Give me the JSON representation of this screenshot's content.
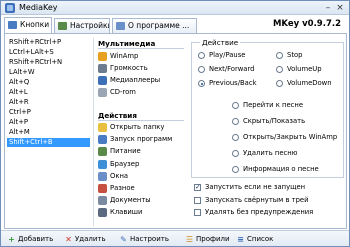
{
  "window": {
    "title": "MediaKey",
    "minimize_glyph": "–",
    "close_glyph": "×"
  },
  "tabs": [
    {
      "label": "Кнопки",
      "icon": "keys-icon",
      "active": true,
      "color": "#4a7cc4"
    },
    {
      "label": "Настройки",
      "icon": "settings-icon",
      "active": false,
      "color": "#5a8a4a"
    },
    {
      "label": "О программе ...",
      "icon": "info-icon",
      "active": false,
      "color": "#6b8fc8"
    }
  ],
  "version": "MKey v0.9.7.2",
  "hotkeys": [
    "RShift+RCtrl+P",
    "LCtrl+LAlt+S",
    "RShift+RCtrl+N",
    "LAlt+W",
    "Alt+Q",
    "Alt+L",
    "Alt+R",
    "Ctrl+P",
    "Alt+P",
    "Alt+M",
    "Shift+Ctrl+B"
  ],
  "selected_hotkey_index": 10,
  "commands": {
    "multimedia_header": "Мультимедиа",
    "multimedia": [
      {
        "label": "WinAmp",
        "icon": "winamp-icon",
        "color": "#e8a020"
      },
      {
        "label": "Громкость",
        "icon": "volume-icon",
        "color": "#6b7c90"
      },
      {
        "label": "Медиаплееры",
        "icon": "media-players-icon",
        "color": "#3d6fb8"
      },
      {
        "label": "CD-rom",
        "icon": "cdrom-icon",
        "color": "#9aa6b4"
      }
    ],
    "actions_header": "Действия",
    "actions": [
      {
        "label": "Открыть папку",
        "icon": "folder-icon",
        "color": "#e8c040"
      },
      {
        "label": "Запуск программ",
        "icon": "run-program-icon",
        "color": "#4a7cc4"
      },
      {
        "label": "Питание",
        "icon": "power-icon",
        "color": "#5a8a4a"
      },
      {
        "label": "Браузер",
        "icon": "browser-icon",
        "color": "#3d8fd8"
      },
      {
        "label": "Окна",
        "icon": "windows-icon",
        "color": "#6b8fc8"
      },
      {
        "label": "Разное",
        "icon": "misc-icon",
        "color": "#c85040"
      },
      {
        "label": "Документы",
        "icon": "documents-icon",
        "color": "#7a8aa0"
      },
      {
        "label": "Клавиши",
        "icon": "keyboard-icon",
        "color": "#5a6a80"
      }
    ]
  },
  "action_group": {
    "title": "Действие",
    "options": [
      {
        "label": "Play/Pause",
        "checked": false
      },
      {
        "label": "Stop",
        "checked": false
      },
      {
        "label": "Next/Forward",
        "checked": false
      },
      {
        "label": "VolumeUp",
        "checked": false
      },
      {
        "label": "Previous/Back",
        "checked": true
      },
      {
        "label": "VolumeDown",
        "checked": false
      },
      {
        "label": "Перейти к песне",
        "checked": false
      },
      {
        "label": "Скрыть/Показать",
        "checked": false
      },
      {
        "label": "Открыть/Закрыть WinAmp",
        "checked": false
      },
      {
        "label": "Удалить песню",
        "checked": false
      },
      {
        "label": "Информация о песне",
        "checked": false
      }
    ]
  },
  "checkboxes": [
    {
      "label": "Запустить если не запущен",
      "checked": true
    },
    {
      "label": "Запускать свёрнутым в трей",
      "checked": false
    },
    {
      "label": "Удалять без предупреждения",
      "checked": false
    }
  ],
  "toolbar": [
    {
      "label": "Добавить",
      "icon": "add-icon",
      "glyph": "+",
      "color": "#3a9a3a"
    },
    {
      "label": "Удалить",
      "icon": "delete-icon",
      "glyph": "✕",
      "color": "#d03a2a"
    },
    {
      "label": "Настроить",
      "icon": "configure-icon",
      "glyph": "✎",
      "color": "#3d6fb8"
    },
    {
      "label": "Профили",
      "icon": "profiles-icon",
      "glyph": "☰",
      "color": "#d09020"
    },
    {
      "label": "Список",
      "icon": "list-icon",
      "glyph": "≡",
      "color": "#3d6fb8"
    }
  ]
}
